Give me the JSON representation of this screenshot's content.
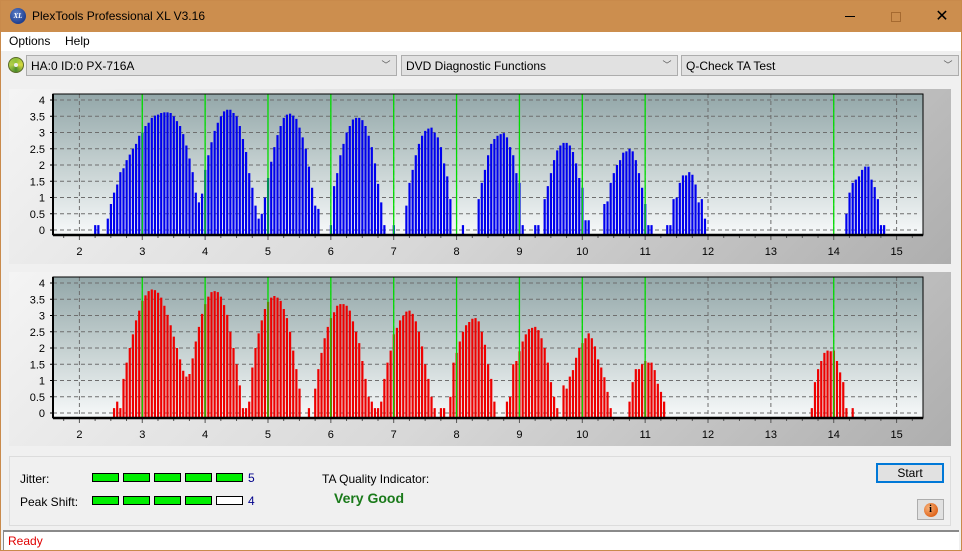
{
  "window": {
    "title": "PlexTools Professional XL V3.16",
    "app_icon": "plextools-logo-icon",
    "app_icon_text": "XL",
    "controls": [
      "minimize",
      "maximize",
      "close"
    ]
  },
  "menu": [
    {
      "label": "Options"
    },
    {
      "label": "Help"
    }
  ],
  "toolbar": {
    "drive_icon": "disc-drive-icon",
    "drive_select": "HA:0 ID:0  PX-716A",
    "function_select": "DVD Diagnostic Functions",
    "test_select": "Q-Check TA Test"
  },
  "colors": {
    "titlebar": "#cc8e4e",
    "top_bars": "#0000ee",
    "bottom_bars": "#ee0000",
    "peak_markers": "#00dd00",
    "meter_on": "#00ee00",
    "quality_text": "#1a7a1a",
    "status_text": "#e00000"
  },
  "chart_data": [
    {
      "type": "bar",
      "name": "TA histogram (lands/top)",
      "color": "#0000ee",
      "xlim": [
        1.58,
        15.42
      ],
      "ylim": [
        0,
        4.2
      ],
      "x_ticks": [
        "2",
        "3",
        "4",
        "5",
        "6",
        "7",
        "8",
        "9",
        "10",
        "11",
        "12",
        "13",
        "14",
        "15"
      ],
      "y_ticks": [
        "0",
        "0.5",
        "1",
        "1.5",
        "2",
        "2.5",
        "3",
        "3.5",
        "4"
      ],
      "grid": true,
      "peak_markers": [
        3,
        4,
        5,
        6,
        7,
        8,
        9,
        10,
        11,
        14
      ],
      "x_start": 2.15,
      "x_step": 0.05,
      "values": [
        0,
        0,
        0.15,
        0.15,
        0,
        0,
        0.35,
        0.8,
        1.15,
        1.4,
        1.78,
        1.9,
        2.15,
        2.32,
        2.5,
        2.65,
        2.9,
        3.0,
        3.2,
        3.3,
        3.45,
        3.52,
        3.55,
        3.6,
        3.62,
        3.62,
        3.6,
        3.5,
        3.35,
        3.2,
        2.95,
        2.6,
        2.2,
        1.78,
        1.15,
        0.85,
        1.12,
        1.85,
        2.3,
        2.7,
        3.05,
        3.3,
        3.5,
        3.65,
        3.7,
        3.7,
        3.6,
        3.5,
        3.2,
        2.8,
        2.4,
        1.75,
        1.3,
        0.75,
        0.35,
        0.5,
        1.0,
        1.6,
        2.1,
        2.55,
        2.92,
        3.2,
        3.45,
        3.55,
        3.58,
        3.52,
        3.42,
        3.15,
        2.85,
        2.5,
        1.95,
        1.3,
        0.75,
        0.65,
        0,
        0,
        0,
        0.15,
        1.35,
        1.75,
        2.3,
        2.65,
        3.0,
        3.2,
        3.4,
        3.45,
        3.45,
        3.38,
        3.2,
        2.9,
        2.55,
        2.05,
        1.42,
        0.85,
        0.15,
        0,
        0,
        0.15,
        0,
        0,
        0,
        0.75,
        1.45,
        1.85,
        2.3,
        2.65,
        2.9,
        3.05,
        3.12,
        3.15,
        3.0,
        2.85,
        2.55,
        2.05,
        1.65,
        0.95,
        0,
        0,
        0,
        0.15,
        0,
        0,
        0,
        0,
        0.95,
        1.45,
        1.85,
        2.3,
        2.65,
        2.8,
        2.9,
        2.95,
        2.98,
        2.85,
        2.55,
        2.3,
        1.75,
        1.45,
        0.15,
        0,
        0,
        0,
        0.15,
        0.15,
        0,
        0.95,
        1.35,
        1.75,
        2.15,
        2.45,
        2.6,
        2.68,
        2.68,
        2.6,
        2.4,
        2.05,
        1.6,
        1.3,
        0.3,
        0.3,
        0,
        0,
        0,
        0,
        0.8,
        0.88,
        1.45,
        1.75,
        2.0,
        2.15,
        2.38,
        2.42,
        2.5,
        2.42,
        2.15,
        1.75,
        1.3,
        0.8,
        0.15,
        0.15,
        0,
        0,
        0,
        0,
        0.15,
        0.15,
        0.95,
        1.0,
        1.45,
        1.68,
        1.68,
        1.78,
        1.7,
        1.4,
        0.85,
        0.95,
        0.35,
        0,
        0,
        0,
        0,
        0,
        0,
        0,
        0,
        0,
        0,
        0,
        0,
        0,
        0,
        0,
        0,
        0,
        0,
        0,
        0,
        0,
        0,
        0,
        0,
        0,
        0,
        0,
        0,
        0,
        0,
        0,
        0,
        0,
        0,
        0,
        0,
        0,
        0,
        0,
        0,
        0,
        0,
        0,
        0,
        0.5,
        1.15,
        1.45,
        1.55,
        1.65,
        1.85,
        1.95,
        1.95,
        1.55,
        1.32,
        0.95,
        0.15,
        0.15
      ]
    },
    {
      "type": "bar",
      "name": "TA histogram (pits/bottom)",
      "color": "#ee0000",
      "xlim": [
        1.58,
        15.42
      ],
      "ylim": [
        0,
        4.2
      ],
      "x_ticks": [
        "2",
        "3",
        "4",
        "5",
        "6",
        "7",
        "8",
        "9",
        "10",
        "11",
        "12",
        "13",
        "14",
        "15"
      ],
      "y_ticks": [
        "0",
        "0.5",
        "1",
        "1.5",
        "2",
        "2.5",
        "3",
        "3.5",
        "4"
      ],
      "grid": true,
      "peak_markers": [
        3,
        4,
        5,
        6,
        7,
        8,
        9,
        10,
        11,
        14
      ],
      "x_start": 2.15,
      "x_step": 0.05,
      "values": [
        0,
        0,
        0,
        0,
        0,
        0,
        0,
        0,
        0.15,
        0.35,
        0.15,
        1.05,
        1.55,
        2.0,
        2.42,
        2.85,
        3.15,
        3.45,
        3.62,
        3.75,
        3.8,
        3.78,
        3.7,
        3.55,
        3.3,
        3.02,
        2.7,
        2.35,
        2.0,
        1.65,
        1.3,
        1.12,
        1.2,
        1.68,
        2.2,
        2.65,
        3.05,
        3.35,
        3.58,
        3.72,
        3.75,
        3.72,
        3.58,
        3.32,
        3.02,
        2.5,
        2.0,
        1.5,
        0.85,
        0.15,
        0.15,
        0.35,
        1.4,
        2.0,
        2.45,
        2.85,
        3.2,
        3.42,
        3.55,
        3.6,
        3.55,
        3.45,
        3.2,
        2.92,
        2.5,
        1.92,
        1.35,
        0.75,
        0,
        0,
        0.15,
        0,
        0.75,
        1.35,
        1.85,
        2.3,
        2.65,
        2.92,
        3.1,
        3.3,
        3.35,
        3.35,
        3.3,
        3.15,
        2.82,
        2.5,
        2.15,
        1.6,
        1.05,
        0.5,
        0.35,
        0.15,
        0.15,
        0.35,
        1.05,
        1.55,
        1.92,
        2.42,
        2.62,
        2.85,
        3.0,
        3.12,
        3.15,
        3.05,
        2.82,
        2.5,
        2.05,
        1.5,
        1.05,
        0.5,
        0.15,
        0,
        0.15,
        0.15,
        0,
        0.5,
        1.55,
        1.85,
        2.2,
        2.5,
        2.7,
        2.8,
        2.9,
        2.92,
        2.82,
        2.5,
        2.1,
        1.5,
        1.05,
        0.35,
        0,
        0,
        0,
        0.35,
        0.5,
        1.5,
        1.6,
        1.9,
        2.2,
        2.42,
        2.58,
        2.62,
        2.65,
        2.55,
        2.3,
        2.0,
        1.55,
        0.95,
        0.5,
        0.15,
        0,
        0.85,
        0.75,
        1.12,
        1.32,
        1.7,
        2.0,
        2.15,
        2.3,
        2.45,
        2.3,
        2.05,
        1.65,
        1.4,
        1.1,
        0.65,
        0.15,
        0,
        0,
        0,
        0,
        0,
        0.35,
        0.95,
        1.35,
        1.35,
        1.5,
        1.6,
        1.55,
        1.55,
        1.32,
        0.9,
        0.65,
        0.35,
        0,
        0,
        0,
        0,
        0,
        0,
        0,
        0,
        0,
        0,
        0,
        0,
        0,
        0,
        0,
        0,
        0,
        0,
        0,
        0,
        0,
        0,
        0,
        0,
        0,
        0,
        0,
        0,
        0,
        0,
        0,
        0,
        0,
        0,
        0,
        0,
        0,
        0,
        0,
        0,
        0,
        0,
        0,
        0,
        0,
        0,
        0.15,
        0.95,
        1.35,
        1.6,
        1.85,
        1.92,
        1.9,
        1.92,
        1.6,
        1.25,
        0.95,
        0.15,
        0,
        0.15
      ]
    }
  ],
  "results": {
    "jitter_label": "Jitter:",
    "jitter_value": "5",
    "jitter_level": 5,
    "peak_shift_label": "Peak Shift:",
    "peak_shift_value": "4",
    "peak_shift_level": 4,
    "meter_max": 5,
    "ta_label": "TA Quality Indicator:",
    "ta_value": "Very Good"
  },
  "buttons": {
    "start": "Start",
    "info_icon": "info-icon"
  },
  "status": {
    "text": "Ready"
  }
}
